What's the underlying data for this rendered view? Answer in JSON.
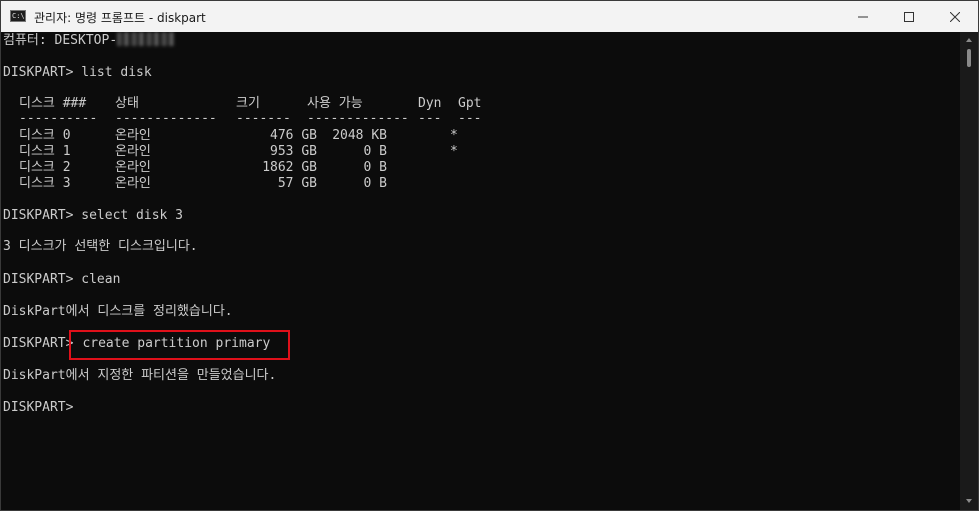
{
  "window": {
    "icon_text": "C:\\",
    "title": "관리자: 명령 프롬프트 - diskpart"
  },
  "console": {
    "computer_line": "컴퓨터: DESKTOP-",
    "cmd_list_disk": "DISKPART> list disk",
    "table": {
      "headers": [
        "디스크 ###",
        "상태",
        "크기",
        "사용 가능",
        "Dyn",
        "Gpt"
      ],
      "separators": [
        "----------",
        "-------------",
        "-------",
        "-------------",
        "---",
        "---"
      ],
      "rows": [
        {
          "disk": "디스크 0",
          "status": "온라인",
          "size": "476 GB",
          "free": "2048 KB",
          "dyn": "",
          "gpt": "*"
        },
        {
          "disk": "디스크 1",
          "status": "온라인",
          "size": "953 GB",
          "free": "0 B",
          "dyn": "",
          "gpt": "*"
        },
        {
          "disk": "디스크 2",
          "status": "온라인",
          "size": "1862 GB",
          "free": "0 B",
          "dyn": "",
          "gpt": ""
        },
        {
          "disk": "디스크 3",
          "status": "온라인",
          "size": "57 GB",
          "free": "0 B",
          "dyn": "",
          "gpt": ""
        }
      ]
    },
    "cmd_select": "DISKPART> select disk 3",
    "msg_select": "3 디스크가 선택한 디스크입니다.",
    "cmd_clean": "DISKPART> clean",
    "msg_clean": "DiskPart에서 디스크를 정리했습니다.",
    "prompt": "DISKPART>",
    "cmd_create": "create partition primary",
    "msg_create": "DiskPart에서 지정한 파티션을 만들었습니다.",
    "final_prompt": "DISKPART>"
  },
  "colors": {
    "background": "#0c0c0c",
    "text": "#cccccc",
    "highlight": "#e0101a"
  },
  "icons": [
    "cmd-app-icon",
    "minimize-icon",
    "maximize-icon",
    "close-icon"
  ]
}
